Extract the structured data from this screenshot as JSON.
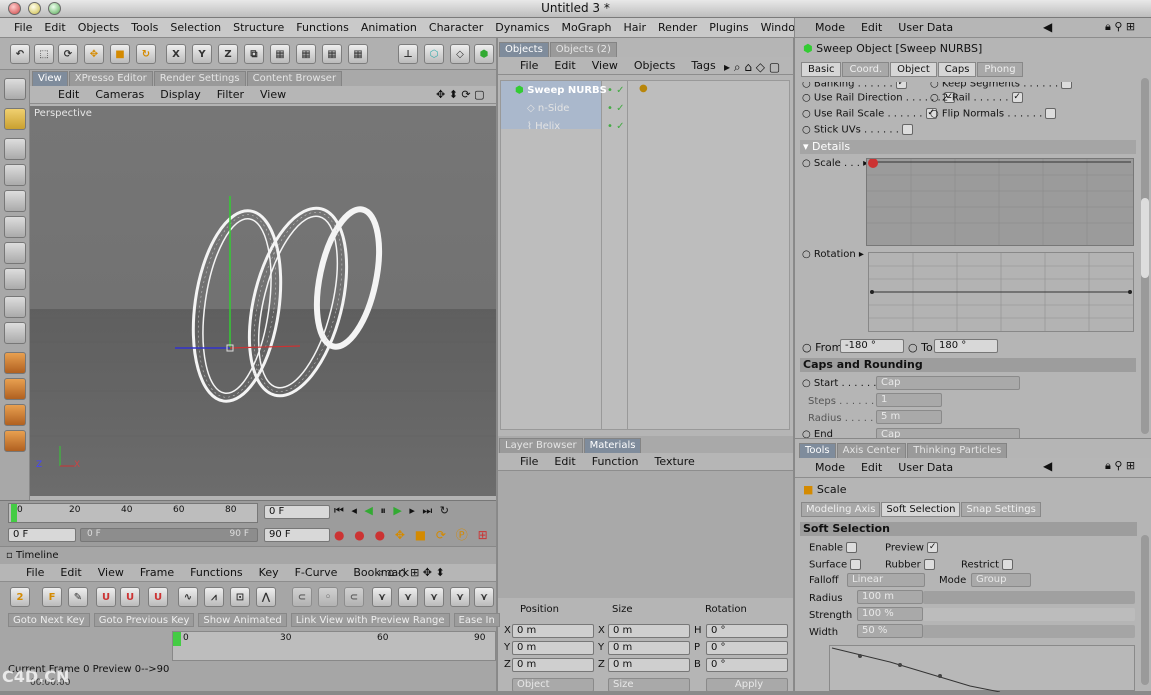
{
  "app": {
    "title": "Untitled 3 *"
  },
  "menu": [
    "File",
    "Edit",
    "Objects",
    "Tools",
    "Selection",
    "Structure",
    "Functions",
    "Animation",
    "Character",
    "Dynamics",
    "MoGraph",
    "Hair",
    "Render",
    "Plugins",
    "Window"
  ],
  "viewport": {
    "tabs": [
      "View",
      "XPresso Editor",
      "Render Settings",
      "Content Browser"
    ],
    "menu": [
      "Edit",
      "Cameras",
      "Display",
      "Filter",
      "View"
    ],
    "label": "Perspective",
    "axis": {
      "z": "Z",
      "x": "X"
    }
  },
  "objects": {
    "tabs": [
      "Objects",
      "Objects (2)"
    ],
    "menu": [
      "File",
      "Edit",
      "View",
      "Objects",
      "Tags"
    ],
    "items": [
      "Sweep NURBS",
      "n-Side",
      "Helix"
    ]
  },
  "attributes": {
    "menu": [
      "Mode",
      "Edit",
      "User Data"
    ],
    "title": "Sweep Object [Sweep NURBS]",
    "tabs": [
      "Basic",
      "Coord.",
      "Object",
      "Caps",
      "Phong"
    ],
    "checks": [
      {
        "label": "Banking",
        "checked": true
      },
      {
        "label": "Keep Segments",
        "checked": false
      },
      {
        "label": "Use Rail Direction",
        "checked": true
      },
      {
        "label": "2-Rail",
        "checked": true
      },
      {
        "label": "Use Rail Scale",
        "checked": true
      },
      {
        "label": "Flip Normals",
        "checked": false
      },
      {
        "label": "Stick UVs",
        "checked": false
      }
    ],
    "details": "Details",
    "scale": "Scale",
    "rotation": "Rotation",
    "from_label": "From",
    "from": "-180 °",
    "to_label": "To",
    "to": "180 °",
    "caps_title": "Caps and Rounding",
    "start_label": "Start",
    "start": "Cap",
    "steps_label": "Steps",
    "steps": "1",
    "radius_label": "Radius",
    "radius": "5 m",
    "end_label": "End",
    "end": "Cap"
  },
  "tools": {
    "tabs": [
      "Tools",
      "Axis Center",
      "Thinking Particles"
    ],
    "menu": [
      "Mode",
      "Edit",
      "User Data"
    ],
    "title": "Scale",
    "subtabs": [
      "Modeling Axis",
      "Soft Selection",
      "Snap Settings"
    ],
    "section": "Soft Selection",
    "enable": "Enable",
    "preview": "Preview",
    "surface": "Surface",
    "rubber": "Rubber",
    "restrict": "Restrict",
    "falloff_label": "Falloff",
    "falloff": "Linear",
    "mode_label": "Mode",
    "mode": "Group",
    "radius_label": "Radius",
    "radius": "100 m",
    "strength_label": "Strength",
    "strength": "100 %",
    "width_label": "Width",
    "width": "50 %"
  },
  "materials": {
    "tabs": [
      "Layer Browser",
      "Materials"
    ],
    "menu": [
      "File",
      "Edit",
      "Function",
      "Texture"
    ]
  },
  "coords": {
    "headers": [
      "Position",
      "Size",
      "Rotation"
    ],
    "rows": [
      [
        "X",
        "0 m",
        "X",
        "0 m",
        "H",
        "0 °"
      ],
      [
        "Y",
        "0 m",
        "Y",
        "0 m",
        "P",
        "0 °"
      ],
      [
        "Z",
        "0 m",
        "Z",
        "0 m",
        "B",
        "0 °"
      ]
    ],
    "mode": "Object",
    "size_mode": "Size",
    "apply": "Apply"
  },
  "time": {
    "ticks": [
      "0",
      "20",
      "40",
      "60",
      "80"
    ],
    "current": "0 F",
    "start": "0 F",
    "min": "0 F",
    "max": "90 F",
    "end": "90 F"
  },
  "timeline": {
    "label": "Timeline",
    "menu": [
      "File",
      "Edit",
      "View",
      "Frame",
      "Functions",
      "Key",
      "F-Curve",
      "Bookmark"
    ],
    "buttons": [
      "Goto Next Key",
      "Goto Previous Key",
      "Show Animated",
      "Link View with Preview Range",
      "Ease In"
    ],
    "ticks": [
      "0",
      "30",
      "60",
      "90"
    ],
    "status": "Current Frame  0  Preview  0-->90",
    "timecode": "00:00:00"
  },
  "watermark": "C4D.CN"
}
